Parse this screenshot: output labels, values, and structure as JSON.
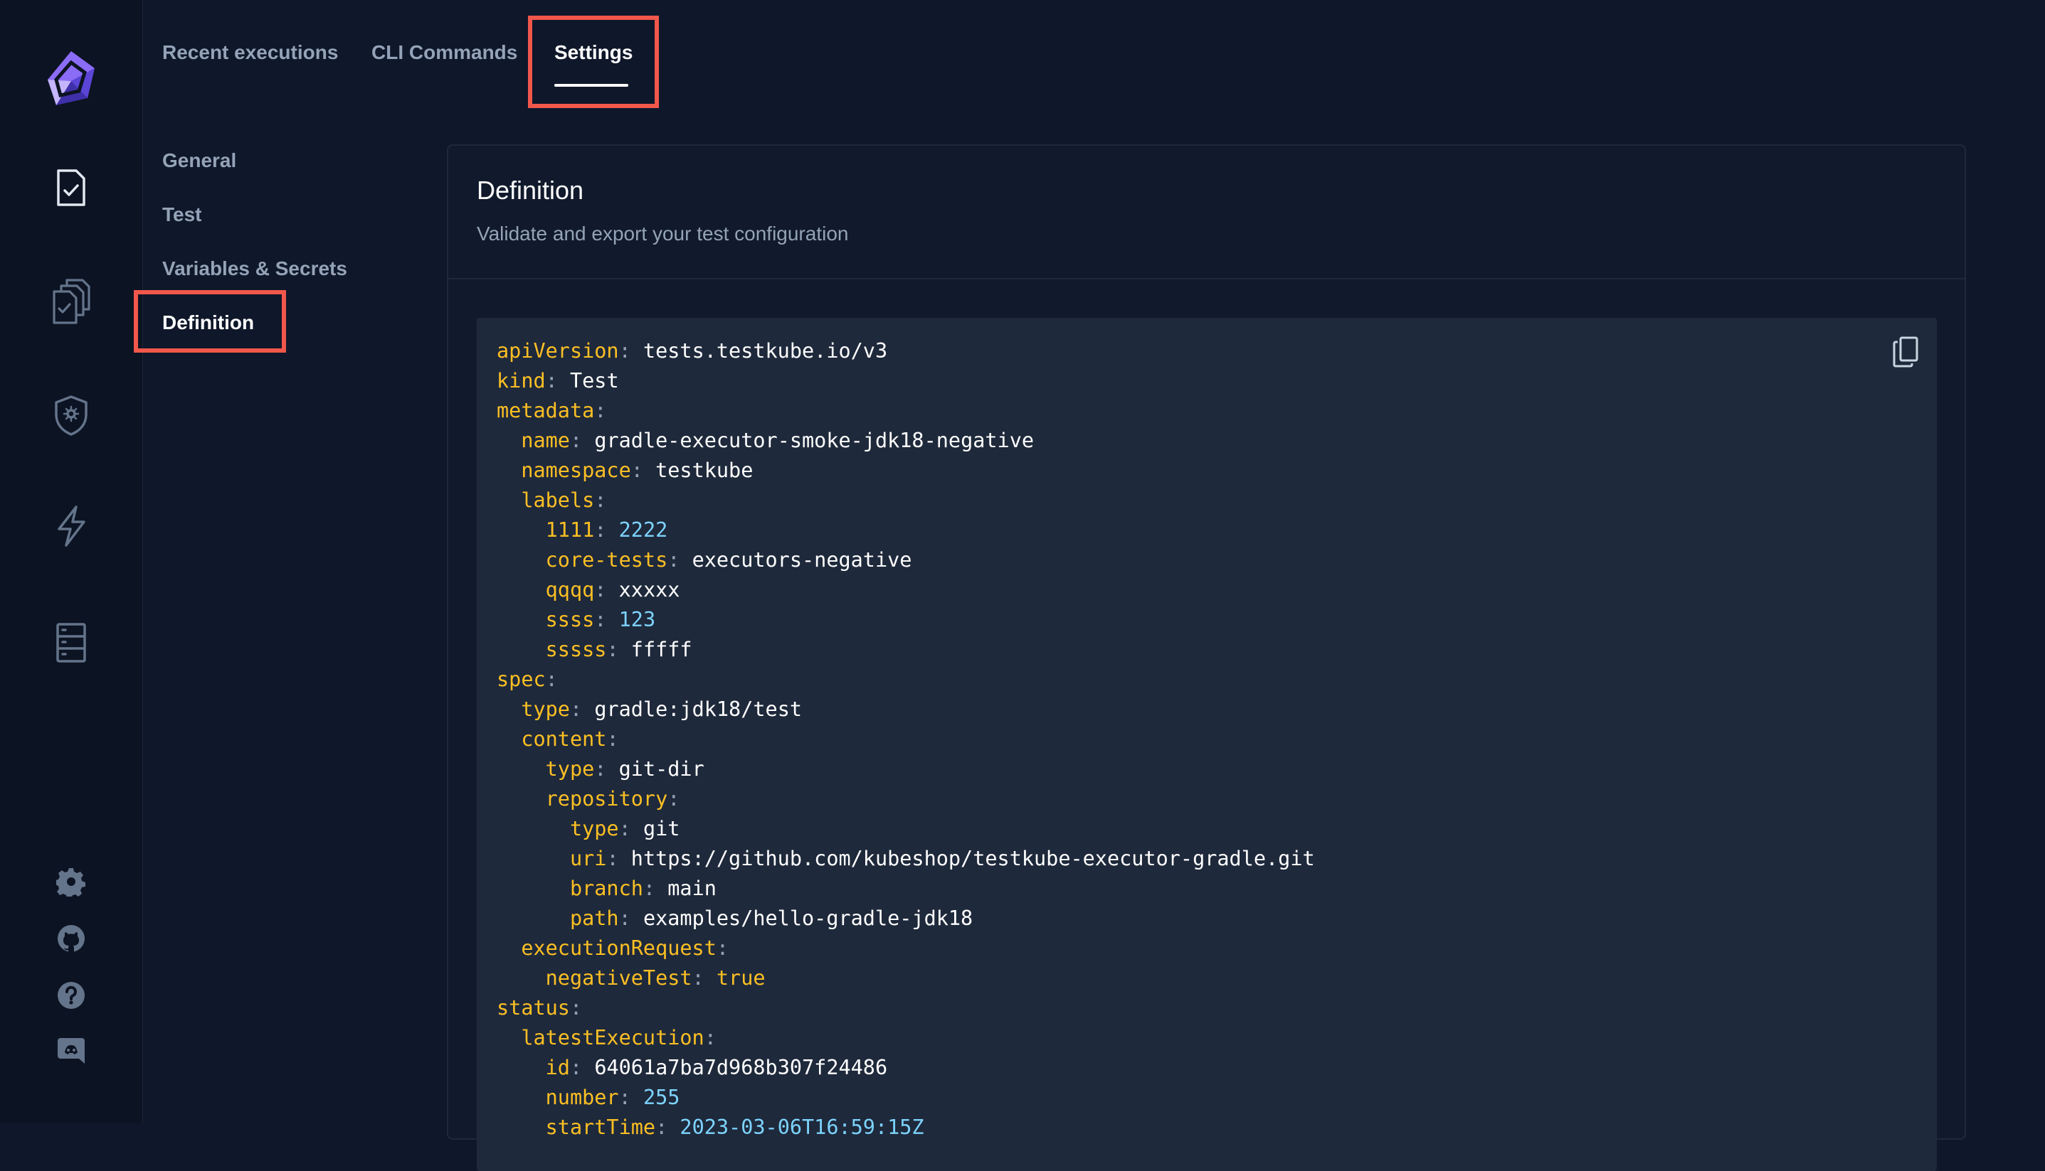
{
  "tabs": [
    {
      "label": "Recent executions",
      "active": false
    },
    {
      "label": "CLI Commands",
      "active": false
    },
    {
      "label": "Settings",
      "active": true
    }
  ],
  "subnav": [
    {
      "label": "General",
      "active": false
    },
    {
      "label": "Test",
      "active": false
    },
    {
      "label": "Variables & Secrets",
      "active": false
    },
    {
      "label": "Definition",
      "active": true
    }
  ],
  "card": {
    "title": "Definition",
    "subtitle": "Validate and export your test configuration"
  },
  "rail_icons": [
    "logo-icon",
    "tests-icon",
    "test-suites-icon",
    "executors-icon",
    "triggers-icon",
    "sources-icon",
    "settings-gear-icon",
    "github-icon",
    "help-icon",
    "discord-icon"
  ],
  "colors": {
    "background": "#0f172a",
    "code_bg": "#1e293b",
    "key": "#fbbf24",
    "number": "#7dd3fc",
    "highlight": "#f1574b",
    "accent": "#7c5cf5"
  },
  "yaml_lines": [
    {
      "indent": "",
      "key": "apiVersion",
      "value": "tests.testkube.io/v3",
      "vtype": "s"
    },
    {
      "indent": "",
      "key": "kind",
      "value": "Test",
      "vtype": "s"
    },
    {
      "indent": "",
      "key": "metadata",
      "value": "",
      "vtype": "s"
    },
    {
      "indent": "  ",
      "key": "name",
      "value": "gradle-executor-smoke-jdk18-negative",
      "vtype": "s"
    },
    {
      "indent": "  ",
      "key": "namespace",
      "value": "testkube",
      "vtype": "s"
    },
    {
      "indent": "  ",
      "key": "labels",
      "value": "",
      "vtype": "s"
    },
    {
      "indent": "    ",
      "key": "1111",
      "value": "2222",
      "vtype": "n"
    },
    {
      "indent": "    ",
      "key": "core-tests",
      "value": "executors-negative",
      "vtype": "s"
    },
    {
      "indent": "    ",
      "key": "qqqq",
      "value": "xxxxx",
      "vtype": "s"
    },
    {
      "indent": "    ",
      "key": "ssss",
      "value": "123",
      "vtype": "n"
    },
    {
      "indent": "    ",
      "key": "sssss",
      "value": "fffff",
      "vtype": "s"
    },
    {
      "indent": "",
      "key": "spec",
      "value": "",
      "vtype": "s"
    },
    {
      "indent": "  ",
      "key": "type",
      "value": "gradle:jdk18/test",
      "vtype": "s"
    },
    {
      "indent": "  ",
      "key": "content",
      "value": "",
      "vtype": "s"
    },
    {
      "indent": "    ",
      "key": "type",
      "value": "git-dir",
      "vtype": "s"
    },
    {
      "indent": "    ",
      "key": "repository",
      "value": "",
      "vtype": "s"
    },
    {
      "indent": "      ",
      "key": "type",
      "value": "git",
      "vtype": "s"
    },
    {
      "indent": "      ",
      "key": "uri",
      "value": "https://github.com/kubeshop/testkube-executor-gradle.git",
      "vtype": "s"
    },
    {
      "indent": "      ",
      "key": "branch",
      "value": "main",
      "vtype": "s"
    },
    {
      "indent": "      ",
      "key": "path",
      "value": "examples/hello-gradle-jdk18",
      "vtype": "s"
    },
    {
      "indent": "  ",
      "key": "executionRequest",
      "value": "",
      "vtype": "s"
    },
    {
      "indent": "    ",
      "key": "negativeTest",
      "value": "true",
      "vtype": "b"
    },
    {
      "indent": "",
      "key": "status",
      "value": "",
      "vtype": "s"
    },
    {
      "indent": "  ",
      "key": "latestExecution",
      "value": "",
      "vtype": "s"
    },
    {
      "indent": "    ",
      "key": "id",
      "value": "64061a7ba7d968b307f24486",
      "vtype": "s"
    },
    {
      "indent": "    ",
      "key": "number",
      "value": "255",
      "vtype": "n"
    },
    {
      "indent": "    ",
      "key": "startTime",
      "value": "2023-03-06T16:59:15Z",
      "vtype": "n"
    }
  ]
}
